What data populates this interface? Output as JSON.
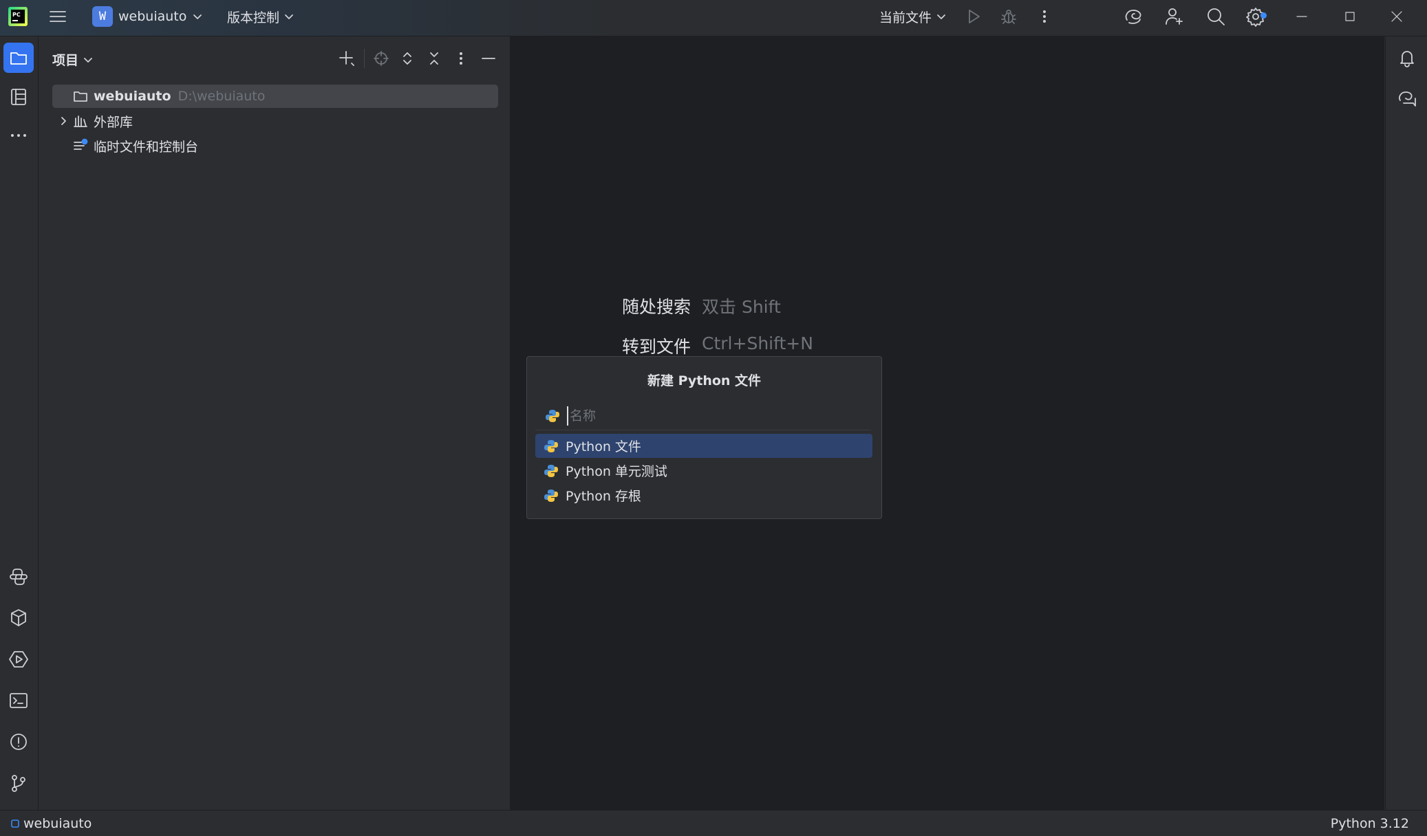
{
  "titlebar": {
    "app_logo_text": "PC",
    "project_badge_letter": "W",
    "project_name": "webuiauto",
    "vcs_label": "版本控制",
    "run_config_label": "当前文件"
  },
  "project_panel": {
    "title": "项目",
    "tree": [
      {
        "name": "webuiauto",
        "path": "D:\\webuiauto"
      },
      {
        "name": "外部库"
      },
      {
        "name": "临时文件和控制台"
      }
    ]
  },
  "editor": {
    "hints": [
      {
        "action": "随处搜索",
        "shortcut": "双击 Shift"
      },
      {
        "action": "转到文件",
        "shortcut": "Ctrl+Shift+N"
      }
    ]
  },
  "popup": {
    "title": "新建 Python 文件",
    "name_placeholder": "名称",
    "options": [
      {
        "label": "Python 文件",
        "selected": true
      },
      {
        "label": "Python 单元测试",
        "selected": false
      },
      {
        "label": "Python 存根",
        "selected": false
      }
    ]
  },
  "statusbar": {
    "project": "webuiauto",
    "interpreter": "Python 3.12"
  },
  "colors": {
    "accent": "#3574f0",
    "selection": "#2e436e",
    "background": "#2b2d30",
    "editor_background": "#1e1f22"
  }
}
